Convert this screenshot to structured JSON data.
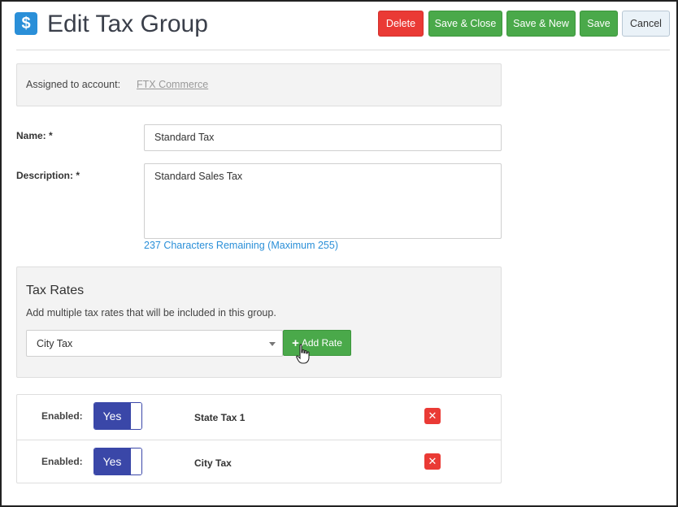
{
  "header": {
    "app_icon": "dollar-icon",
    "title": "Edit Tax Group",
    "buttons": {
      "delete": "Delete",
      "save_close": "Save & Close",
      "save_new": "Save & New",
      "save": "Save",
      "cancel": "Cancel"
    }
  },
  "account": {
    "label": "Assigned to account:",
    "value": "FTX Commerce"
  },
  "form": {
    "name_label": "Name: *",
    "name_value": "Standard Tax",
    "description_label": "Description: *",
    "description_value": "Standard Sales Tax",
    "char_count": "237 Characters Remaining (Maximum 255)"
  },
  "tax_rates": {
    "title": "Tax Rates",
    "description": "Add multiple tax rates that will be included in this group.",
    "selected": "City Tax",
    "add_button": "Add Rate",
    "add_icon": "plus-icon"
  },
  "rates": [
    {
      "enabled_label": "Enabled:",
      "toggle": "Yes",
      "name": "State Tax 1"
    },
    {
      "enabled_label": "Enabled:",
      "toggle": "Yes",
      "name": "City Tax"
    }
  ],
  "colors": {
    "accent_blue": "#2a8fd8",
    "danger_red": "#ea3a35",
    "success_green": "#4aa94a",
    "toggle_blue": "#3a47a8"
  }
}
